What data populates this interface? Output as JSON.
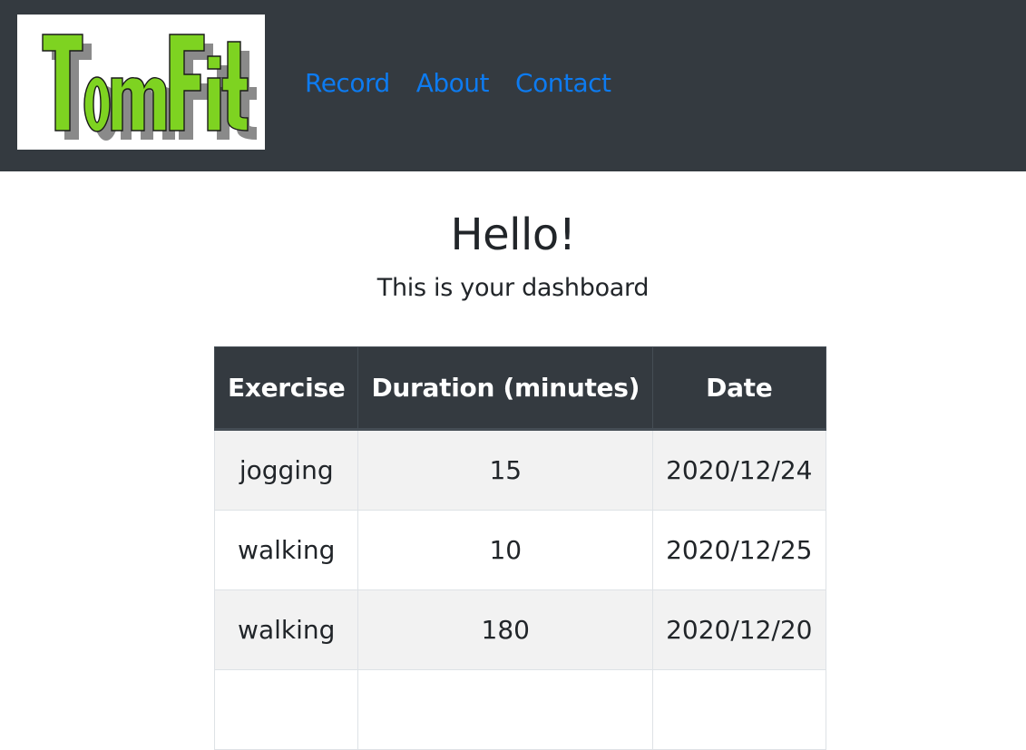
{
  "brand": {
    "logo_text": "TomFit",
    "colors": {
      "fill": "#7ed321",
      "shadow": "#8a8a8a",
      "outline": "#1a1a1a"
    }
  },
  "nav": {
    "links": [
      {
        "label": "Record"
      },
      {
        "label": "About"
      },
      {
        "label": "Contact"
      }
    ],
    "link_color": "#0d7bf0",
    "bar_color": "#343a40"
  },
  "main": {
    "title": "Hello!",
    "subtitle": "This is your dashboard"
  },
  "table": {
    "columns": [
      "Exercise",
      "Duration (minutes)",
      "Date"
    ],
    "rows": [
      {
        "exercise": "jogging",
        "duration": "15",
        "date": "2020/12/24"
      },
      {
        "exercise": "walking",
        "duration": "10",
        "date": "2020/12/25"
      },
      {
        "exercise": "walking",
        "duration": "180",
        "date": "2020/12/20"
      },
      {
        "exercise": "",
        "duration": "",
        "date": ""
      }
    ]
  }
}
